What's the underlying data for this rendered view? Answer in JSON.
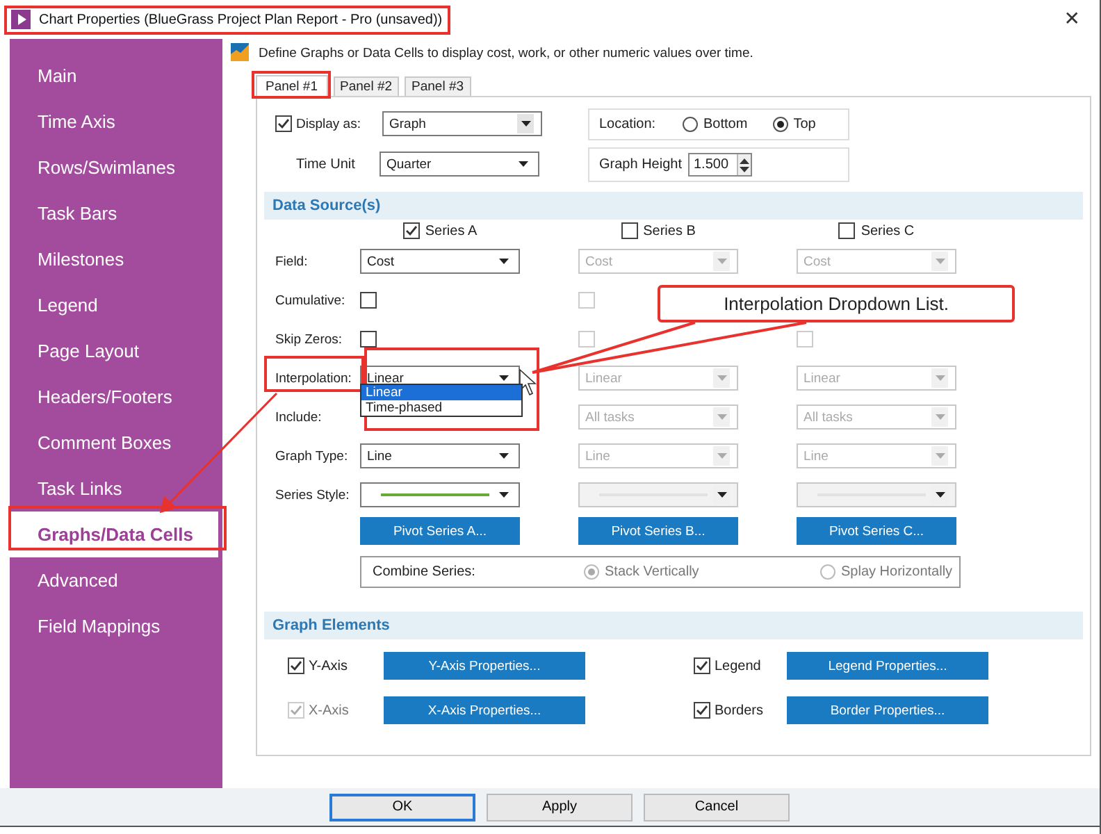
{
  "window": {
    "title": "Chart Properties (BlueGrass Project Plan Report - Pro (unsaved))",
    "close": "✕"
  },
  "sidebar": {
    "items": [
      {
        "label": "Main",
        "selected": false
      },
      {
        "label": "Time Axis",
        "selected": false
      },
      {
        "label": "Rows/Swimlanes",
        "selected": false
      },
      {
        "label": "Task Bars",
        "selected": false
      },
      {
        "label": "Milestones",
        "selected": false
      },
      {
        "label": "Legend",
        "selected": false
      },
      {
        "label": "Page Layout",
        "selected": false
      },
      {
        "label": "Headers/Footers",
        "selected": false
      },
      {
        "label": "Comment Boxes",
        "selected": false
      },
      {
        "label": "Task Links",
        "selected": false
      },
      {
        "label": "Graphs/Data Cells",
        "selected": true
      },
      {
        "label": "Advanced",
        "selected": false
      },
      {
        "label": "Field Mappings",
        "selected": false
      }
    ]
  },
  "description": "Define Graphs or Data Cells to display cost, work, or other numeric values over time.",
  "tabs": [
    {
      "label": "Panel #1",
      "selected": true
    },
    {
      "label": "Panel #2",
      "selected": false
    },
    {
      "label": "Panel #3",
      "selected": false
    }
  ],
  "display_as": {
    "label": "Display as:",
    "checked": true,
    "value": "Graph"
  },
  "time_unit": {
    "label": "Time Unit",
    "value": "Quarter"
  },
  "location": {
    "label": "Location:",
    "options": [
      {
        "label": "Bottom",
        "selected": false
      },
      {
        "label": "Top",
        "selected": true
      }
    ]
  },
  "graph_height": {
    "label": "Graph Height",
    "value": "1.500"
  },
  "data_sources": {
    "title": "Data Source(s)",
    "series": [
      {
        "label": "Series A",
        "checked": true
      },
      {
        "label": "Series B",
        "checked": false
      },
      {
        "label": "Series C",
        "checked": false
      }
    ],
    "rows": [
      {
        "label": "Field:",
        "kind": "dropdown",
        "cells": [
          {
            "value": "Cost",
            "disabled": false
          },
          {
            "value": "Cost",
            "disabled": true
          },
          {
            "value": "Cost",
            "disabled": true
          }
        ]
      },
      {
        "label": "Cumulative:",
        "kind": "checkbox",
        "cells": [
          {
            "checked": false,
            "disabled": false
          },
          {
            "checked": false,
            "disabled": true
          }
        ]
      },
      {
        "label": "Skip Zeros:",
        "kind": "checkbox",
        "cells": [
          {
            "checked": false,
            "disabled": false
          },
          {
            "checked": false,
            "disabled": true
          },
          {
            "checked": false,
            "disabled": true
          }
        ]
      },
      {
        "label": "Interpolation:",
        "kind": "dropdown",
        "cells": [
          {
            "value": "Linear",
            "disabled": false,
            "expanded": true,
            "options": [
              {
                "label": "Linear",
                "selected": true
              },
              {
                "label": "Time-phased",
                "selected": false
              }
            ]
          },
          {
            "value": "Linear",
            "disabled": true
          },
          {
            "value": "Linear",
            "disabled": true
          }
        ]
      },
      {
        "label": "Include:",
        "kind": "dropdown",
        "cells": [
          "",
          {
            "value": "All tasks",
            "disabled": true
          },
          {
            "value": "All tasks",
            "disabled": true
          }
        ]
      },
      {
        "label": "Graph Type:",
        "kind": "dropdown",
        "cells": [
          {
            "value": "Line",
            "disabled": false
          },
          {
            "value": "Line",
            "disabled": true
          },
          {
            "value": "Line",
            "disabled": true
          }
        ]
      },
      {
        "label": "Series Style:",
        "kind": "style",
        "cells": [
          {
            "color": "#6aaa3a",
            "disabled": false
          },
          {
            "color": "#e2e2e2",
            "disabled": true
          },
          {
            "color": "#e2e2e2",
            "disabled": true
          }
        ]
      },
      {
        "kind": "button",
        "cells": [
          {
            "value": "Pivot Series A..."
          },
          {
            "value": "Pivot Series B..."
          },
          {
            "value": "Pivot Series C..."
          }
        ]
      }
    ],
    "combine": {
      "label": "Combine Series:",
      "disabled": true,
      "options": [
        {
          "label": "Stack Vertically",
          "selected": true
        },
        {
          "label": "Splay Horizontally",
          "selected": false
        }
      ]
    }
  },
  "graph_elements": {
    "title": "Graph Elements",
    "items": [
      {
        "label": "Y-Axis",
        "checked": true,
        "disabled": false,
        "button": "Y-Axis Properties..."
      },
      {
        "label": "Legend",
        "checked": true,
        "disabled": false,
        "button": "Legend Properties..."
      },
      {
        "label": "X-Axis",
        "checked": true,
        "disabled": true,
        "button": "X-Axis Properties..."
      },
      {
        "label": "Borders",
        "checked": true,
        "disabled": false,
        "button": "Border Properties..."
      }
    ]
  },
  "buttons": [
    {
      "label": "OK",
      "default": true
    },
    {
      "label": "Apply",
      "default": false
    },
    {
      "label": "Cancel",
      "default": false
    }
  ],
  "callout": {
    "text": "Interpolation Dropdown List."
  }
}
